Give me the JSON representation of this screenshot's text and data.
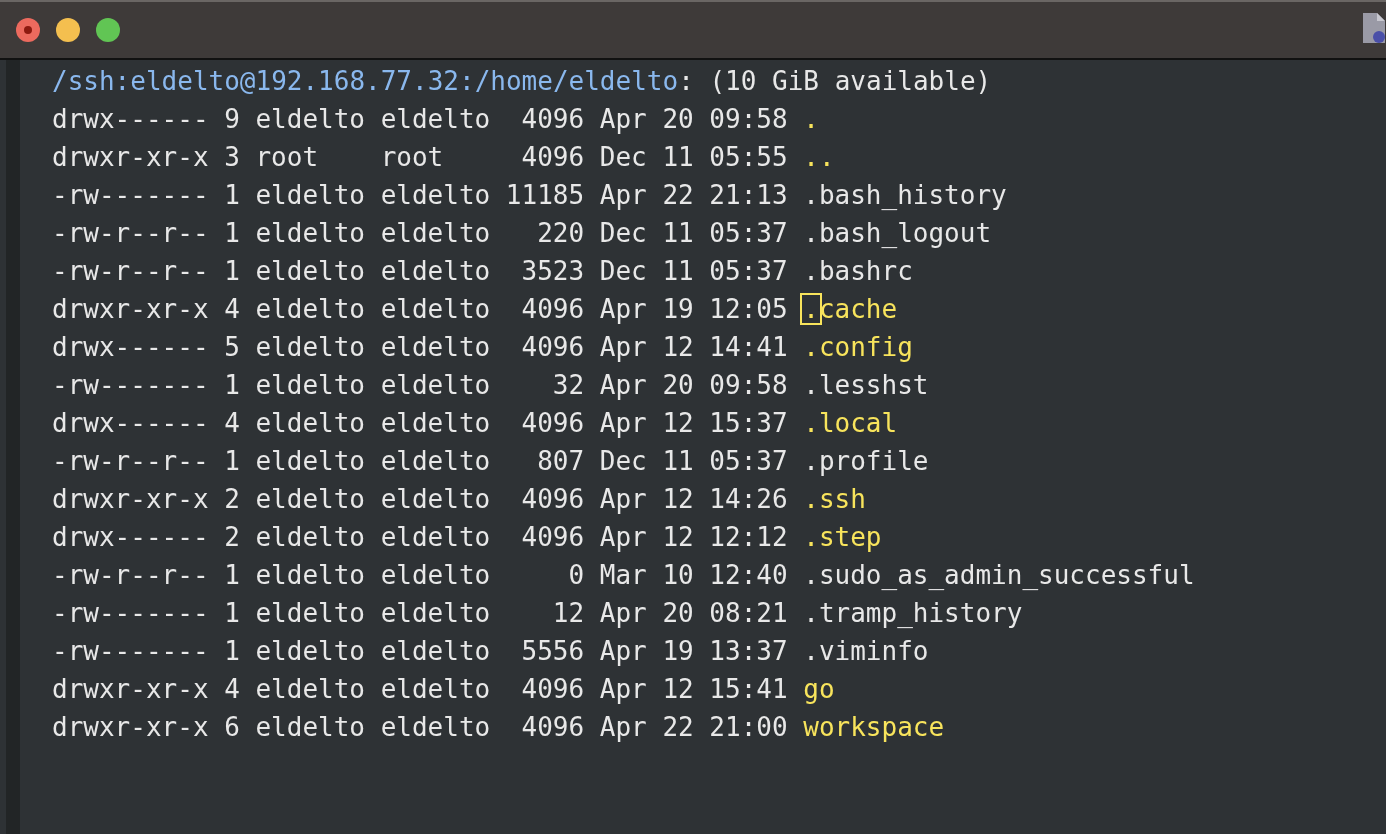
{
  "header": {
    "path": "/ssh:eldelto@192.168.77.32:/home/eldelto",
    "info": ": (10 GiB available)"
  },
  "rows": [
    {
      "kind": "dir",
      "perms": "drwx------",
      "links": "9",
      "owner": "eldelto",
      "group": "eldelto",
      "size": "4096",
      "date": "Apr 20 09:58",
      "name": ".",
      "cursor": false
    },
    {
      "kind": "dir",
      "perms": "drwxr-xr-x",
      "links": "3",
      "owner": "root",
      "group": "root",
      "size": "4096",
      "date": "Dec 11 05:55",
      "name": "..",
      "cursor": false
    },
    {
      "kind": "file",
      "perms": "-rw-------",
      "links": "1",
      "owner": "eldelto",
      "group": "eldelto",
      "size": "11185",
      "date": "Apr 22 21:13",
      "name": ".bash_history",
      "cursor": false
    },
    {
      "kind": "file",
      "perms": "-rw-r--r--",
      "links": "1",
      "owner": "eldelto",
      "group": "eldelto",
      "size": "220",
      "date": "Dec 11 05:37",
      "name": ".bash_logout",
      "cursor": false
    },
    {
      "kind": "file",
      "perms": "-rw-r--r--",
      "links": "1",
      "owner": "eldelto",
      "group": "eldelto",
      "size": "3523",
      "date": "Dec 11 05:37",
      "name": ".bashrc",
      "cursor": false
    },
    {
      "kind": "dir",
      "perms": "drwxr-xr-x",
      "links": "4",
      "owner": "eldelto",
      "group": "eldelto",
      "size": "4096",
      "date": "Apr 19 12:05",
      "name": ".cache",
      "cursor": true
    },
    {
      "kind": "dir",
      "perms": "drwx------",
      "links": "5",
      "owner": "eldelto",
      "group": "eldelto",
      "size": "4096",
      "date": "Apr 12 14:41",
      "name": ".config",
      "cursor": false
    },
    {
      "kind": "file",
      "perms": "-rw-------",
      "links": "1",
      "owner": "eldelto",
      "group": "eldelto",
      "size": "32",
      "date": "Apr 20 09:58",
      "name": ".lesshst",
      "cursor": false
    },
    {
      "kind": "dir",
      "perms": "drwx------",
      "links": "4",
      "owner": "eldelto",
      "group": "eldelto",
      "size": "4096",
      "date": "Apr 12 15:37",
      "name": ".local",
      "cursor": false
    },
    {
      "kind": "file",
      "perms": "-rw-r--r--",
      "links": "1",
      "owner": "eldelto",
      "group": "eldelto",
      "size": "807",
      "date": "Dec 11 05:37",
      "name": ".profile",
      "cursor": false
    },
    {
      "kind": "dir",
      "perms": "drwxr-xr-x",
      "links": "2",
      "owner": "eldelto",
      "group": "eldelto",
      "size": "4096",
      "date": "Apr 12 14:26",
      "name": ".ssh",
      "cursor": false
    },
    {
      "kind": "dir",
      "perms": "drwx------",
      "links": "2",
      "owner": "eldelto",
      "group": "eldelto",
      "size": "4096",
      "date": "Apr 12 12:12",
      "name": ".step",
      "cursor": false
    },
    {
      "kind": "file",
      "perms": "-rw-r--r--",
      "links": "1",
      "owner": "eldelto",
      "group": "eldelto",
      "size": "0",
      "date": "Mar 10 12:40",
      "name": ".sudo_as_admin_successful",
      "cursor": false
    },
    {
      "kind": "file",
      "perms": "-rw-------",
      "links": "1",
      "owner": "eldelto",
      "group": "eldelto",
      "size": "12",
      "date": "Apr 20 08:21",
      "name": ".tramp_history",
      "cursor": false
    },
    {
      "kind": "file",
      "perms": "-rw-------",
      "links": "1",
      "owner": "eldelto",
      "group": "eldelto",
      "size": "5556",
      "date": "Apr 19 13:37",
      "name": ".viminfo",
      "cursor": false
    },
    {
      "kind": "dir",
      "perms": "drwxr-xr-x",
      "links": "4",
      "owner": "eldelto",
      "group": "eldelto",
      "size": "4096",
      "date": "Apr 12 15:41",
      "name": "go",
      "cursor": false
    },
    {
      "kind": "dir",
      "perms": "drwxr-xr-x",
      "links": "6",
      "owner": "eldelto",
      "group": "eldelto",
      "size": "4096",
      "date": "Apr 22 21:00",
      "name": "workspace",
      "cursor": false
    }
  ]
}
